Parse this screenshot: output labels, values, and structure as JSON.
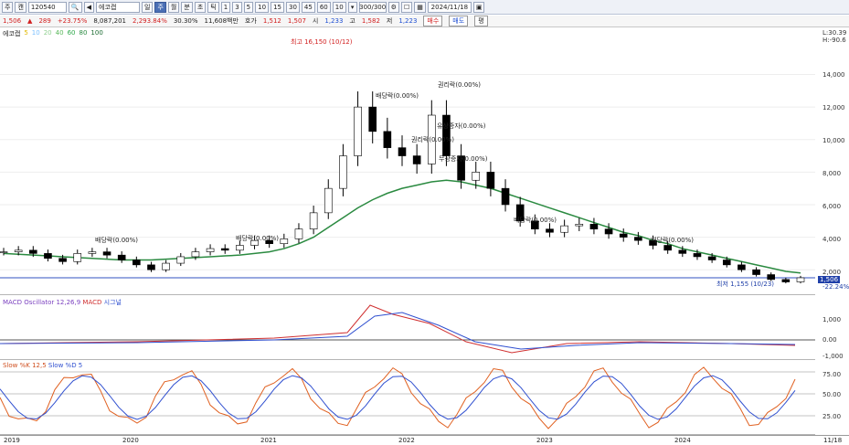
{
  "toolbar": {
    "type_label": "주",
    "type_label2": "캔",
    "code": "120540",
    "name": "에코캡",
    "period_buttons": [
      "일",
      "주",
      "월",
      "분",
      "초",
      "틱"
    ],
    "selected_period": "주",
    "minute_buttons": [
      "1",
      "3",
      "5",
      "10",
      "15",
      "30",
      "45",
      "60"
    ],
    "tick_value": "10",
    "count": "300/300",
    "date": "2024/11/18"
  },
  "quote": {
    "price": "1,506",
    "change": "289",
    "change_pct": "+23.75%",
    "volume": "8,087,201",
    "volume_pct": "2,293.84%",
    "turnover_pct": "30.30%",
    "amount": "11,608백만",
    "bid_label": "호가",
    "bid": "1,512",
    "ask": "1,507",
    "high_label": "시",
    "open": "1,233",
    "high_label2": "고",
    "high": "1,582",
    "low_label": "저",
    "low": "1,223",
    "buy_label": "매수",
    "sell_label": "매도",
    "setting_label": "평"
  },
  "legend": {
    "name": "에코캡",
    "ma_values": [
      "5",
      "10",
      "20",
      "40",
      "60",
      "80",
      "100"
    ],
    "colors": [
      "#ffd400",
      "#7ac0ff",
      "#b0e0b0",
      "#78d878",
      "#2ea84a",
      "#2a8a40",
      "#1a6a30"
    ]
  },
  "price_axis": {
    "ticks": [
      "14,000",
      "12,000",
      "10,000",
      "8,000",
      "6,000",
      "4,000",
      "2,000"
    ],
    "top_note1": "L:30.39",
    "top_note2": "H:-90.6",
    "current": "1,506",
    "current_pct": "-22.24%"
  },
  "annotations": {
    "high": "최고 16,150 (10/12)",
    "low": "최저 1,155 (10/23)",
    "events": [
      "배당락(0.00%)",
      "배당락(0.00%)",
      "배당락(0.00%)",
      "권리락(0.00%)",
      "유상증자(0.00%)",
      "권리락(0.00%)",
      "무상증자(0.00%)",
      "배당락(0.00%)",
      "배당락(0.00%)"
    ]
  },
  "macd": {
    "title": "MACD Oscillator 12,26,9",
    "title2": "MACD",
    "title3": "시그널",
    "ticks": [
      "1,000",
      "0.00",
      "-1,000"
    ]
  },
  "stoch": {
    "title": "Slow %K 12,5",
    "title2": "Slow %D 5",
    "ticks": [
      "75.00",
      "50.00",
      "25.00"
    ]
  },
  "x_axis": {
    "labels": [
      "2019",
      "2020",
      "2021",
      "2022",
      "2023",
      "2024",
      "11/18"
    ]
  },
  "chart_data": {
    "type": "line",
    "price_weekly_close": [
      3100,
      3200,
      3000,
      2700,
      2500,
      3000,
      3100,
      2900,
      2600,
      2300,
      2000,
      2400,
      2800,
      3100,
      3300,
      3200,
      3500,
      3800,
      3600,
      3900,
      4500,
      5500,
      7000,
      9000,
      12000,
      10500,
      9500,
      9000,
      8500,
      11500,
      9000,
      7500,
      8000,
      7000,
      6000,
      5000,
      4500,
      4300,
      4700,
      4800,
      4500,
      4200,
      4000,
      3800,
      3500,
      3200,
      3000,
      2800,
      2600,
      2300,
      2000,
      1700,
      1400,
      1250,
      1506
    ],
    "ma_long": [
      3000,
      2950,
      2900,
      2850,
      2800,
      2750,
      2700,
      2650,
      2600,
      2600,
      2600,
      2650,
      2700,
      2750,
      2800,
      2850,
      2900,
      3000,
      3100,
      3300,
      3600,
      4000,
      4600,
      5200,
      5800,
      6300,
      6700,
      7000,
      7200,
      7400,
      7500,
      7400,
      7200,
      7000,
      6700,
      6400,
      6100,
      5800,
      5500,
      5200,
      4900,
      4600,
      4300,
      4100,
      3800,
      3600,
      3300,
      3100,
      2900,
      2700,
      2500,
      2300,
      2100,
      1900,
      1800
    ],
    "ylim": [
      1000,
      16500
    ]
  }
}
